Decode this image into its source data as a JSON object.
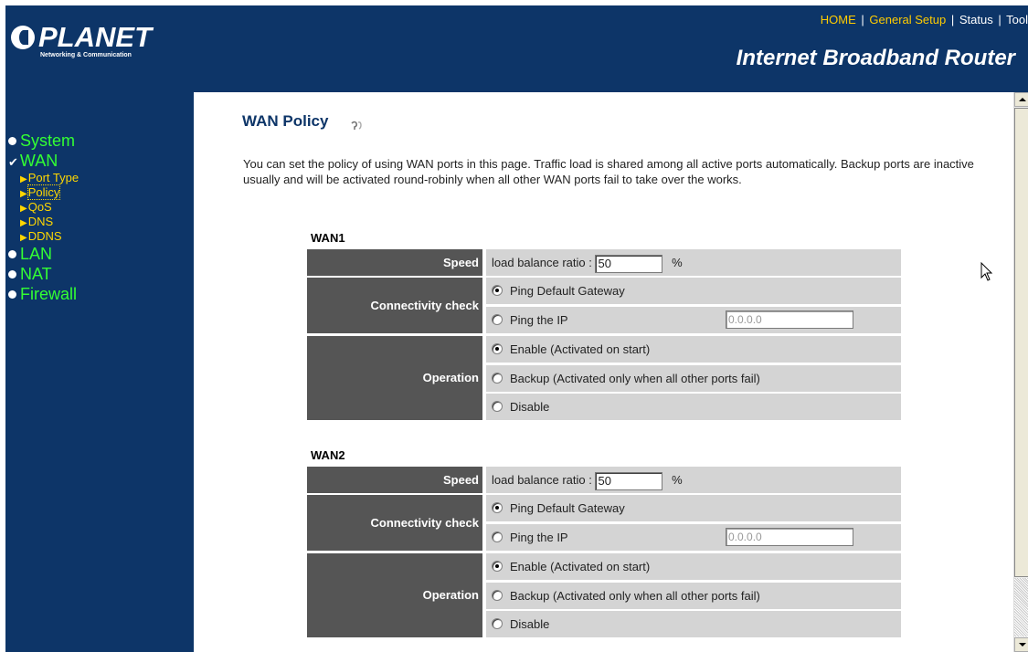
{
  "header": {
    "logo_text": "PLANET",
    "logo_tagline": "Networking & Communication",
    "product_title": "Internet Broadband Router",
    "nav": [
      {
        "label": "HOME",
        "color": "#ffcc00"
      },
      {
        "label": "General Setup",
        "color": "#ffcc00"
      },
      {
        "label": "Status",
        "color": "#ffffff"
      },
      {
        "label": "Tool",
        "color": "#ffffff"
      }
    ],
    "separator": "|"
  },
  "sidebar": {
    "items": [
      {
        "label": "System",
        "icon": "bullet-icon"
      },
      {
        "label": "WAN",
        "icon": "check-icon"
      },
      {
        "label": "LAN",
        "icon": "bullet-icon"
      },
      {
        "label": "NAT",
        "icon": "bullet-icon"
      },
      {
        "label": "Firewall",
        "icon": "bullet-icon"
      }
    ],
    "wan_sub": [
      "Port Type",
      "Policy",
      "QoS",
      "DNS",
      "DDNS"
    ],
    "active_sub": "Policy"
  },
  "main": {
    "title": "WAN Policy",
    "intro": "You can set the policy of using WAN ports in this page. Traffic load is shared among all active ports automatically. Backup ports are inactive usually and will be activated round-robinly when all other WAN ports fail to take over the works.",
    "labels": {
      "speed": "Speed",
      "connectivity": "Connectivity check",
      "operation": "Operation",
      "load_balance": "load balance ratio :",
      "percent": "%",
      "ping_gateway": "Ping Default Gateway",
      "ping_ip": "Ping the IP",
      "enable": "Enable (Activated on start)",
      "backup": "Backup (Activated only when all other ports fail)",
      "disable": "Disable"
    },
    "wan1": {
      "name": "WAN1",
      "ratio": "50",
      "ip": "0.0.0.0",
      "conn": "gateway",
      "op": "enable"
    },
    "wan2": {
      "name": "WAN2",
      "ratio": "50",
      "ip": "0.0.0.0",
      "conn": "gateway",
      "op": "enable"
    }
  },
  "colors": {
    "header_bg": "#0d3568",
    "menu_green": "#33ff33",
    "submenu_yellow": "#ffd700",
    "label_bg": "#555555",
    "cell_bg": "#d4d4d4"
  }
}
